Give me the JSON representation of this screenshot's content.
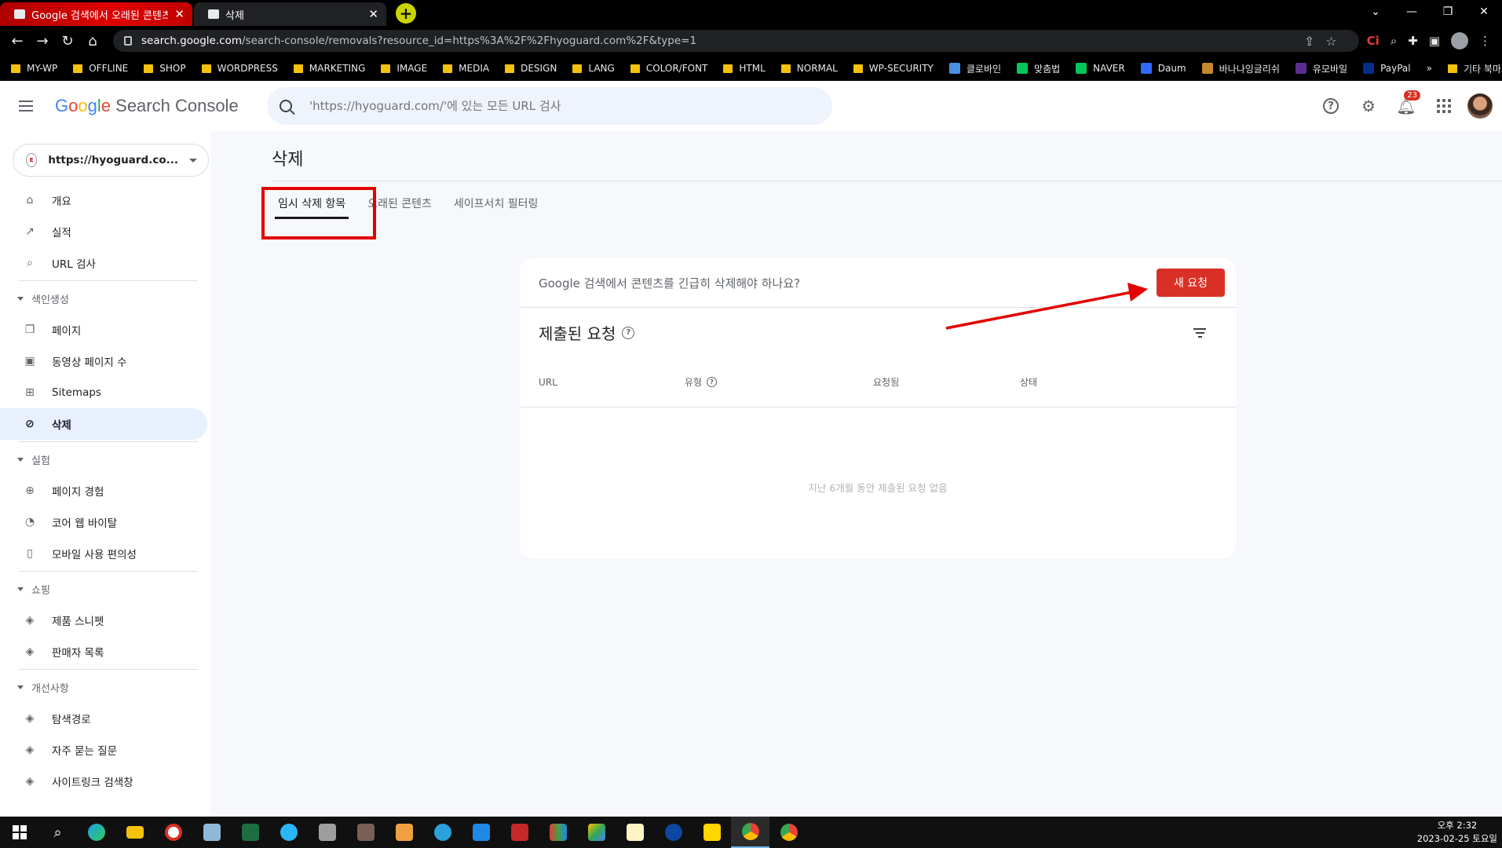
{
  "browser": {
    "tabs": [
      {
        "title": "Google 검색에서 오래된 콘텐츠",
        "active": false
      },
      {
        "title": "삭제",
        "active": true
      }
    ],
    "url_host": "search.google.com",
    "url_path": "/search-console/removals?resource_id=https%3A%2F%2Fhyoguard.com%2F&type=1",
    "bookmarks": [
      "MY-WP",
      "OFFLINE",
      "SHOP",
      "WORDPRESS",
      "MARKETING",
      "IMAGE",
      "MEDIA",
      "DESIGN",
      "LANG",
      "COLOR/FONT",
      "HTML",
      "NORMAL",
      "WP-SECURITY",
      "클로바인",
      "맞춤법",
      "NAVER",
      "Daum",
      "바나나잉글리쉬",
      "유모바일",
      "PayPal"
    ],
    "bookmarks_more": "»",
    "other_bookmarks": "기타 북마크"
  },
  "header": {
    "product_name": "Search Console",
    "search_placeholder": "'https://hyoguard.com/'에 있는 모든 URL 검사",
    "notification_count": "23"
  },
  "sidebar": {
    "property": "https://hyoguard.co...",
    "items_top": [
      {
        "label": "개요",
        "icon": "home-icon"
      },
      {
        "label": "실적",
        "icon": "trending-icon"
      },
      {
        "label": "URL 검사",
        "icon": "search-icon"
      }
    ],
    "section_index": "색인생성",
    "items_index": [
      {
        "label": "페이지",
        "icon": "pages-icon"
      },
      {
        "label": "동영상 페이지 수",
        "icon": "video-icon"
      },
      {
        "label": "Sitemaps",
        "icon": "sitemap-icon"
      },
      {
        "label": "삭제",
        "icon": "eye-off-icon",
        "active": true
      }
    ],
    "section_experience": "실험",
    "items_experience": [
      {
        "label": "페이지 경험",
        "icon": "plus-circle-icon"
      },
      {
        "label": "코어 웹 바이탈",
        "icon": "gauge-icon"
      },
      {
        "label": "모바일 사용 편의성",
        "icon": "phone-icon"
      }
    ],
    "section_shopping": "쇼핑",
    "items_shopping": [
      {
        "label": "제품 스니펫",
        "icon": "layers-icon"
      },
      {
        "label": "판매자 목록",
        "icon": "layers-icon"
      }
    ],
    "section_enhancements": "개선사항",
    "items_enhancements": [
      {
        "label": "탐색경로",
        "icon": "layers-icon"
      },
      {
        "label": "자주 묻는 질문",
        "icon": "layers-icon"
      },
      {
        "label": "사이트링크 검색창",
        "icon": "layers-icon"
      }
    ]
  },
  "main": {
    "title": "삭제",
    "tabs": [
      "임시 삭제 항목",
      "오래된 콘텐츠",
      "세이프서치 필터링"
    ],
    "active_tab": 0,
    "card": {
      "question": "Google 검색에서 콘텐츠를 긴급히 삭제해야 하나요?",
      "new_request_label": "새 요청",
      "heading": "제출된 요청",
      "columns": [
        "URL",
        "유형",
        "요청됨",
        "상태"
      ],
      "empty_message": "지난 6개월 동안 제출된 요청 없음"
    }
  },
  "taskbar": {
    "time": "오후 2:32",
    "date": "2023-02-25 토요일"
  },
  "colors": {
    "accent_red": "#d93025",
    "highlight_red": "#e30000",
    "active_nav": "#e8f0fe"
  }
}
